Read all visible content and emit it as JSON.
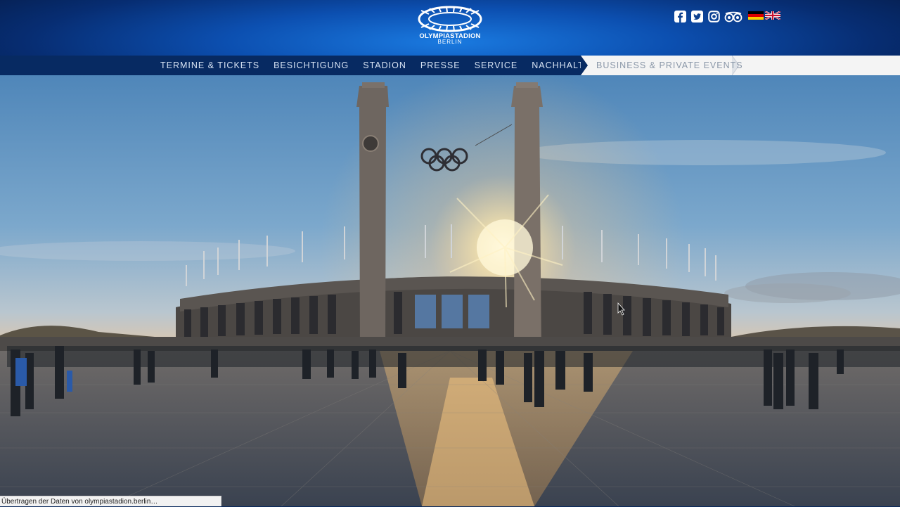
{
  "header": {
    "logo_title": "OLYMPIASTADION",
    "logo_subtitle": "BERLIN",
    "social_icons": [
      "facebook-icon",
      "twitter-icon",
      "instagram-icon",
      "tripadvisor-icon"
    ],
    "languages": [
      "de",
      "en"
    ]
  },
  "nav": {
    "items": [
      {
        "label": "TERMINE & TICKETS"
      },
      {
        "label": "BESICHTIGUNG"
      },
      {
        "label": "STADION"
      },
      {
        "label": "PRESSE"
      },
      {
        "label": "SERVICE"
      },
      {
        "label": "NACHHALTIGKEIT"
      }
    ],
    "events_label": "BUSINESS & PRIVATE EVENTS"
  },
  "status_bar": {
    "text": "Übertragen der Daten von olympiastadion.berlin…"
  },
  "colors": {
    "header_bg": "#0c4fb0",
    "nav_bg": "#072a62",
    "nav_text": "#d8e4f4",
    "events_bg": "#f4f4f4",
    "events_text": "#8a97a8"
  }
}
